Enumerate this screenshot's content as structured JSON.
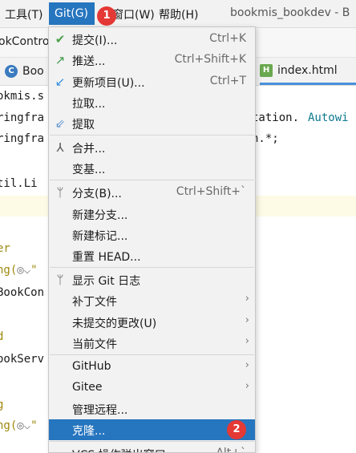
{
  "menubar": {
    "tools": "工具(T)",
    "git": "Git(G)",
    "window": "窗口(W)",
    "help": "帮助(H)",
    "project_title": "bookmis_bookdev - B"
  },
  "breadcrumb": "okContro",
  "tabs": [
    {
      "label": "Boo",
      "icon": "class-c-icon"
    },
    {
      "label": "index.html",
      "icon": "html-h-icon"
    }
  ],
  "editor": {
    "lines": {
      "l1": "okmis.s",
      "l2a": "ringfra",
      "l2b": "tation.",
      "l2c": "Autowi",
      "l3a": "ringfra",
      "l3b": "n.*;",
      "l4": "til.Li",
      "l5": "er",
      "l6a": "ng(",
      "l6b": "\"",
      "l7": "BookCon",
      "l8": "d",
      "l9": "ookServ",
      "l10": "g",
      "l11a": "ng(",
      "l11b": "\""
    }
  },
  "menu": {
    "commit": {
      "label": "提交(I)...",
      "shortcut": "Ctrl+K",
      "icon": "check-icon"
    },
    "push": {
      "label": "推送...",
      "shortcut": "Ctrl+Shift+K",
      "icon": "push-arrow-icon"
    },
    "update": {
      "label": "更新项目(U)...",
      "shortcut": "Ctrl+T",
      "icon": "update-arrow-icon"
    },
    "pull": {
      "label": "拉取..."
    },
    "fetch": {
      "label": "提取",
      "icon": "fetch-icon"
    },
    "merge": {
      "label": "合并...",
      "icon": "merge-icon"
    },
    "rebase": {
      "label": "变基..."
    },
    "branches": {
      "label": "分支(B)...",
      "shortcut": "Ctrl+Shift+`",
      "icon": "branch-icon"
    },
    "new_branch": {
      "label": "新建分支..."
    },
    "new_tag": {
      "label": "新建标记..."
    },
    "reset_head": {
      "label": "重置 HEAD..."
    },
    "show_log": {
      "label": "显示 Git 日志",
      "icon": "git-log-icon"
    },
    "patch": {
      "label": "补丁文件"
    },
    "uncommitted": {
      "label": "未提交的更改(U)"
    },
    "current_file": {
      "label": "当前文件"
    },
    "github": {
      "label": "GitHub"
    },
    "gitee": {
      "label": "Gitee"
    },
    "manage_remotes": {
      "label": "管理远程..."
    },
    "clone": {
      "label": "克隆..."
    },
    "vcs_popup": {
      "label": "VCS 操作弹出窗口",
      "shortcut": "Alt+`"
    }
  },
  "badges": {
    "b1": "1",
    "b2": "2"
  },
  "colors": {
    "accent": "#2675bf",
    "badge": "#e53935",
    "check": "#4aa14a",
    "arrow": "#2f8ce0"
  }
}
